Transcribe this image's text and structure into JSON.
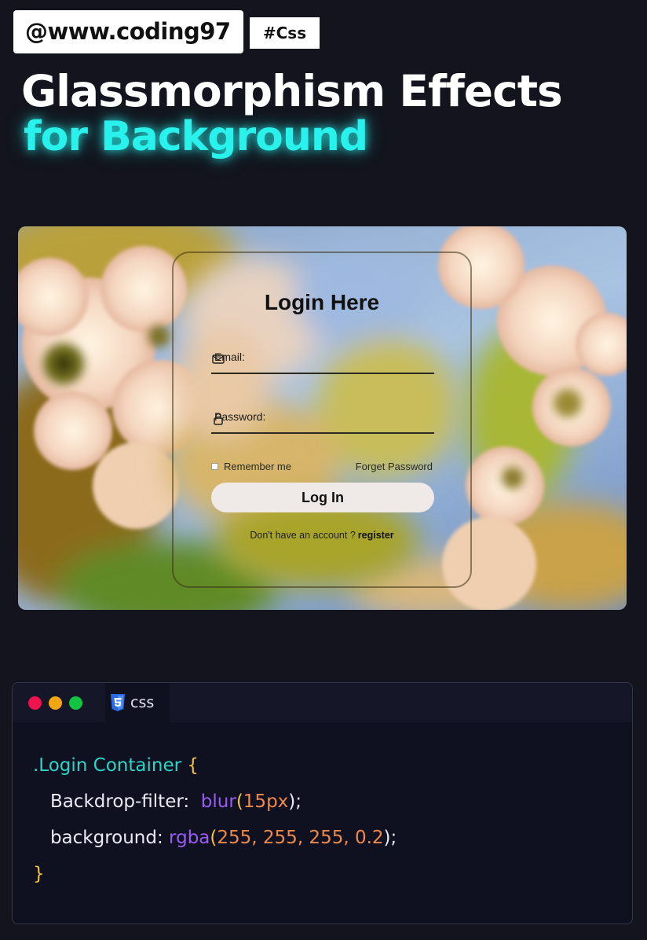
{
  "header": {
    "handle": "@www.coding97",
    "tag": "#Css"
  },
  "headline": {
    "line1": "Glassmorphism Effects",
    "line2": "for Background",
    "accent_color": "#29f2ec"
  },
  "login_form": {
    "title": "Login Here",
    "email_label": "Email:",
    "password_label": "Password:",
    "remember_label": "Remember me",
    "forgot_label": "Forget Password",
    "login_button": "Log In",
    "signup_prompt": "Don't have an account ?",
    "signup_link": "register"
  },
  "code_panel": {
    "tab_label": "css",
    "tab_icon": "css3-icon",
    "window_controls": [
      "close-dot",
      "minimize-dot",
      "maximize-dot"
    ],
    "selector": ".Login Container",
    "open_brace": "{",
    "close_brace": "}",
    "line1_prop": "Backdrop-filter:",
    "line1_fn": "blur",
    "line1_open": "(",
    "line1_arg": "15px",
    "line1_end": ");",
    "line2_prop": "background:",
    "line2_fn": "rgba",
    "line2_open": "(",
    "line2_arg": "255, 255, 255, 0.2",
    "line2_end": ");"
  }
}
